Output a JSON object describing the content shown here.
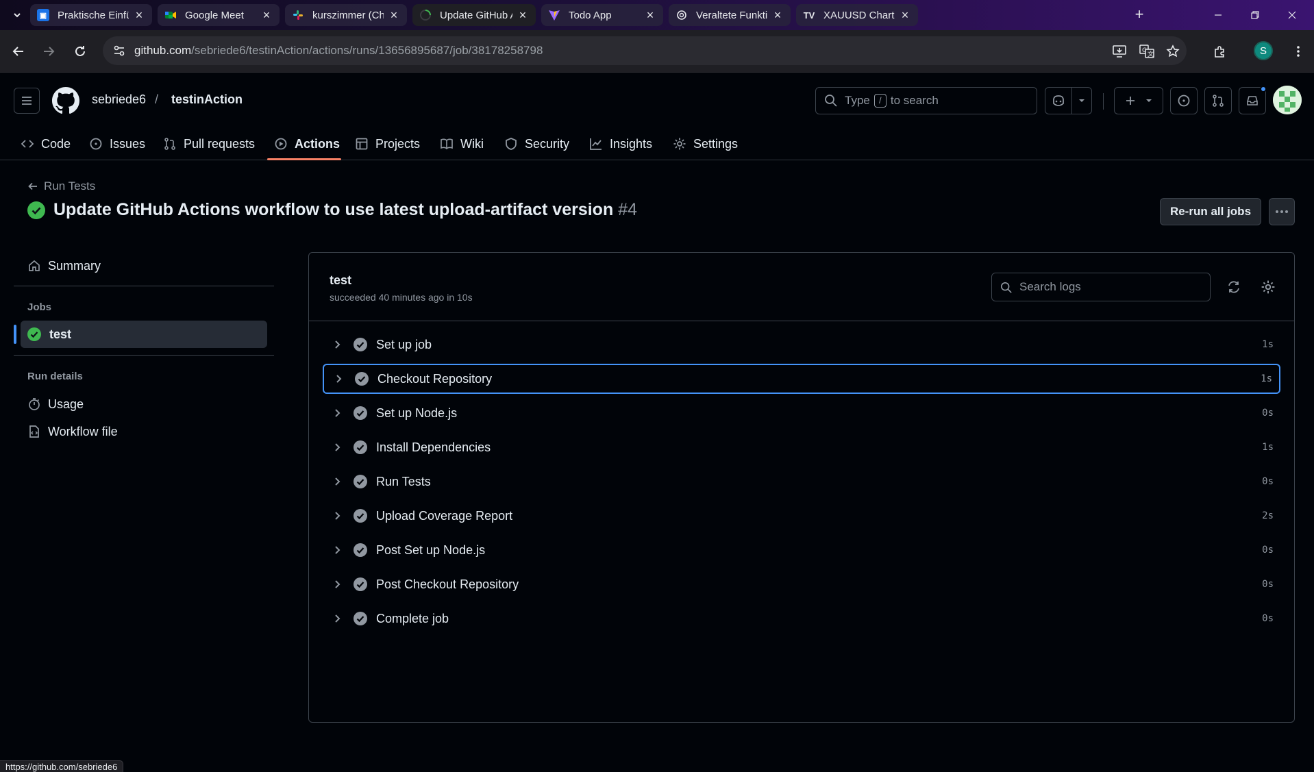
{
  "browser": {
    "tabs": [
      {
        "title": "Praktische Einführung",
        "active": false
      },
      {
        "title": "Google Meet",
        "active": false
      },
      {
        "title": "kurszimmer (Channel)",
        "active": false
      },
      {
        "title": "Update GitHub Actio",
        "active": true
      },
      {
        "title": "Todo App",
        "active": false
      },
      {
        "title": "Veraltete Funktionen",
        "active": false
      },
      {
        "title": "XAUUSD Chart — Go",
        "active": false
      }
    ],
    "url_host": "github.com",
    "url_path": "/sebriede6/testinAction/actions/runs/13656895687/job/38178258798",
    "profile_initial": "S",
    "status_url": "https://github.com/sebriede6"
  },
  "header": {
    "owner": "sebriede6",
    "separator": "/",
    "repo": "testinAction",
    "search_prefix": "Type",
    "search_key": "/",
    "search_suffix": "to search"
  },
  "repo_nav": [
    {
      "label": "Code",
      "icon": "code-icon"
    },
    {
      "label": "Issues",
      "icon": "issue-icon"
    },
    {
      "label": "Pull requests",
      "icon": "pull-request-icon"
    },
    {
      "label": "Actions",
      "icon": "play-icon"
    },
    {
      "label": "Projects",
      "icon": "table-icon"
    },
    {
      "label": "Wiki",
      "icon": "book-icon"
    },
    {
      "label": "Security",
      "icon": "shield-icon"
    },
    {
      "label": "Insights",
      "icon": "graph-icon"
    },
    {
      "label": "Settings",
      "icon": "gear-icon"
    }
  ],
  "run": {
    "back_label": "Run Tests",
    "title": "Update GitHub Actions workflow to use latest upload-artifact version",
    "number": "#4",
    "rerun_label": "Re-run all jobs"
  },
  "sidebar": {
    "summary_label": "Summary",
    "jobs_heading": "Jobs",
    "active_job": "test",
    "run_details_heading": "Run details",
    "usage_label": "Usage",
    "workflow_label": "Workflow file"
  },
  "job": {
    "name": "test",
    "meta": "succeeded 40 minutes ago in 10s",
    "search_placeholder": "Search logs",
    "steps": [
      {
        "name": "Set up job",
        "duration": "1s"
      },
      {
        "name": "Checkout Repository",
        "duration": "1s"
      },
      {
        "name": "Set up Node.js",
        "duration": "0s"
      },
      {
        "name": "Install Dependencies",
        "duration": "1s"
      },
      {
        "name": "Run Tests",
        "duration": "0s"
      },
      {
        "name": "Upload Coverage Report",
        "duration": "2s"
      },
      {
        "name": "Post Set up Node.js",
        "duration": "0s"
      },
      {
        "name": "Post Checkout Repository",
        "duration": "0s"
      },
      {
        "name": "Complete job",
        "duration": "0s"
      }
    ]
  },
  "colors": {
    "success": "#3fb950",
    "accent": "#4493f8",
    "underline": "#f78166"
  }
}
